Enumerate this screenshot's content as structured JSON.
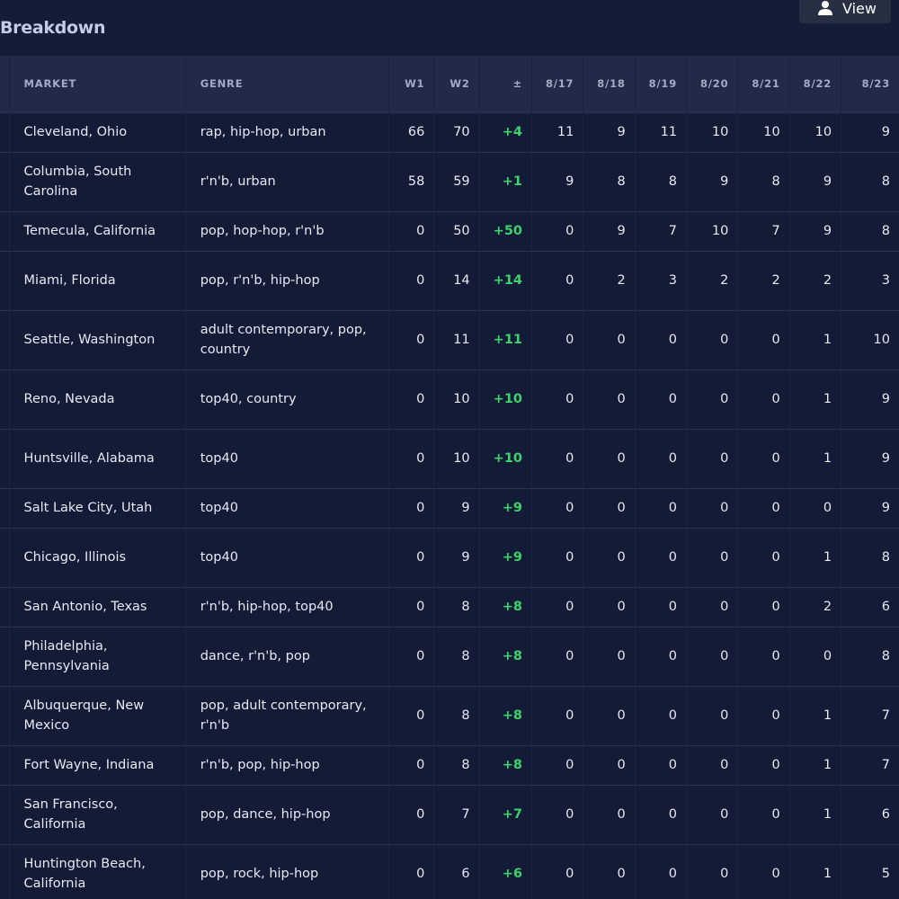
{
  "section": {
    "title": "Breakdown"
  },
  "view_button": {
    "label": "View",
    "icon": "user-icon"
  },
  "colors": {
    "background": "#131b36",
    "header": "#212a48",
    "positive": "#3ed36a",
    "button": "#272f42"
  },
  "table": {
    "columns": [
      "MARKET",
      "GENRE",
      "W1",
      "W2",
      "±",
      "8/17",
      "8/18",
      "8/19",
      "8/20",
      "8/21",
      "8/22",
      "8/23"
    ],
    "rows": [
      [
        "Cleveland, Ohio",
        "rap, hip-hop, urban",
        "66",
        "70",
        "+4",
        "11",
        "9",
        "11",
        "10",
        "10",
        "10",
        "9"
      ],
      [
        "Columbia, South Carolina",
        "r'n'b, urban",
        "58",
        "59",
        "+1",
        "9",
        "8",
        "8",
        "9",
        "8",
        "9",
        "8"
      ],
      [
        "Temecula, California",
        "pop, hop-hop, r'n'b",
        "0",
        "50",
        "+50",
        "0",
        "9",
        "7",
        "10",
        "7",
        "9",
        "8"
      ],
      [
        "Miami, Florida",
        "pop, r'n'b, hip-hop",
        "0",
        "14",
        "+14",
        "0",
        "2",
        "3",
        "2",
        "2",
        "2",
        "3"
      ],
      [
        "Seattle, Washington",
        "adult contemporary, pop, country",
        "0",
        "11",
        "+11",
        "0",
        "0",
        "0",
        "0",
        "0",
        "1",
        "10"
      ],
      [
        "Reno, Nevada",
        "top40, country",
        "0",
        "10",
        "+10",
        "0",
        "0",
        "0",
        "0",
        "0",
        "1",
        "9"
      ],
      [
        "Huntsville, Alabama",
        "top40",
        "0",
        "10",
        "+10",
        "0",
        "0",
        "0",
        "0",
        "0",
        "1",
        "9"
      ],
      [
        "Salt Lake City, Utah",
        "top40",
        "0",
        "9",
        "+9",
        "0",
        "0",
        "0",
        "0",
        "0",
        "0",
        "9"
      ],
      [
        "Chicago, Illinois",
        "top40",
        "0",
        "9",
        "+9",
        "0",
        "0",
        "0",
        "0",
        "0",
        "1",
        "8"
      ],
      [
        "San Antonio, Texas",
        "r'n'b, hip-hop, top40",
        "0",
        "8",
        "+8",
        "0",
        "0",
        "0",
        "0",
        "0",
        "2",
        "6"
      ],
      [
        "Philadelphia, Pennsylvania",
        "dance, r'n'b, pop",
        "0",
        "8",
        "+8",
        "0",
        "0",
        "0",
        "0",
        "0",
        "0",
        "8"
      ],
      [
        "Albuquerque, New Mexico",
        "pop, adult contemporary, r'n'b",
        "0",
        "8",
        "+8",
        "0",
        "0",
        "0",
        "0",
        "0",
        "1",
        "7"
      ],
      [
        "Fort Wayne, Indiana",
        "r'n'b, pop, hip-hop",
        "0",
        "8",
        "+8",
        "0",
        "0",
        "0",
        "0",
        "0",
        "1",
        "7"
      ],
      [
        "San Francisco, California",
        "pop, dance, hip-hop",
        "0",
        "7",
        "+7",
        "0",
        "0",
        "0",
        "0",
        "0",
        "1",
        "6"
      ],
      [
        "Huntington Beach, California",
        "pop, rock, hip-hop",
        "0",
        "6",
        "+6",
        "0",
        "0",
        "0",
        "0",
        "0",
        "1",
        "5"
      ]
    ]
  }
}
